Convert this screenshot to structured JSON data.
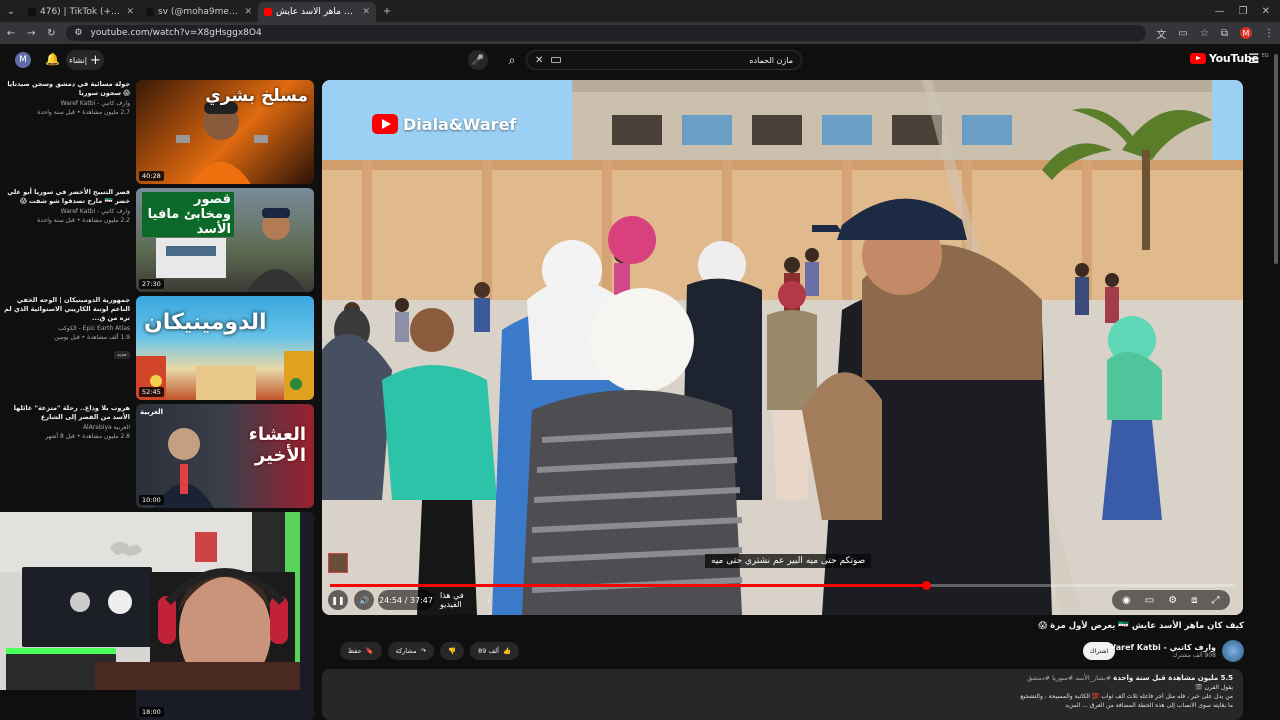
{
  "browser": {
    "tabs": [
      {
        "title": "476) | TikTok ارطن بيجي (99+)",
        "active": false,
        "icon": "tiktok-icon"
      },
      {
        "title": "sv (@moha9med52) | TikTok",
        "active": false,
        "icon": "tiktok-icon"
      },
      {
        "title": "كيف كان ماهر الأسد عايش!...",
        "active": true,
        "icon": "youtube-icon"
      }
    ],
    "url": "youtube.com/watch?v=X8gHsggx8O4"
  },
  "header": {
    "avatar_letter": "M",
    "create_label": "إنشاء",
    "search_query": "مازن الحماده",
    "logo_text": "YouTube",
    "logo_country": "EG"
  },
  "recommendations": [
    {
      "title": "جولة مسائية في دمشق وسجن صيدنايا 😱 سجون سوريا",
      "channel": "وارف كاتبي - Waref Katbi",
      "stats": "2.7 مليون مشاهدة • قبل سنة واحدة",
      "duration": "40:28",
      "thumb_text": "مسلخ بشري"
    },
    {
      "title": "قصر التنبيح الأخضر في سوريا أبو علي خضر 🇸🇾 مارح تصدقوا شو شفت 😱",
      "channel": "وارف كاتبي - Waref Katbi",
      "stats": "2.2 مليون مشاهدة • قبل سنة واحدة",
      "duration": "27:30",
      "thumb_text": "قصور ومخابئ مافيا الأسد"
    },
    {
      "title": "جمهورية الدومينيكان | الوجه الخفي الناعم لوتنة الكاريبي الاستوائية الذي لم تره من ق...",
      "channel": "Epic Earth Atlas - الكوكب",
      "stats": "1.9 ألف مشاهدة • قبل يومين",
      "duration": "52:45",
      "thumb_text": "الدومينيكان",
      "badge": "جديد"
    },
    {
      "title": "هروب بلا وداع.. رحلة \"متزعة\" عائلها الأسد من القصر إلى الشارع",
      "channel": "العربية AlArabiya",
      "stats": "2.8 مليون مشاهدة • قبل 8 أشهر",
      "duration": "10:00",
      "thumb_text": "العشاء الأخير",
      "thumb_brand": "العربية"
    }
  ],
  "webcam_duration": "18:00",
  "player": {
    "watermark": "Diala&Waref",
    "subtitle": "صوتكم حتى ميه البير عم نشتري حتى ميه",
    "time": "24:54 / 37:47",
    "chapter": "في هذا الفيديو",
    "progress_fraction": 0.659
  },
  "video": {
    "title": "كيف كان ماهر الأسد عايش 🇸🇾 يعرض لأول مرة 😱",
    "channel_name": "وارف كاتبي - Waref Katbi",
    "subscribers": "908 ألف مشترك",
    "subscribe_label": "اشتراك",
    "likes": "89 ألف",
    "share_label": "مشاركة",
    "save_label": "حفظ"
  },
  "description": {
    "stats": "5.5 مليون مشاهدة  قبل سنة واحدة",
    "tags": "#بشار_الأسد #سوريا #دمشق",
    "line1": "يقول القرن 🎬",
    "line2": "من بدل على خير ، فله مثل أجر فاعله ثلاث ألف ثواب 💯 الكاتبة والمسيحة ، والتشجيع",
    "line3": "ما بغايته سوى الانصاب إلى هذه الخطة المضافة من العرق ... المزيد"
  },
  "colors": {
    "accent": "#ff0000",
    "background": "#0f0f0f",
    "surface": "#272727"
  }
}
